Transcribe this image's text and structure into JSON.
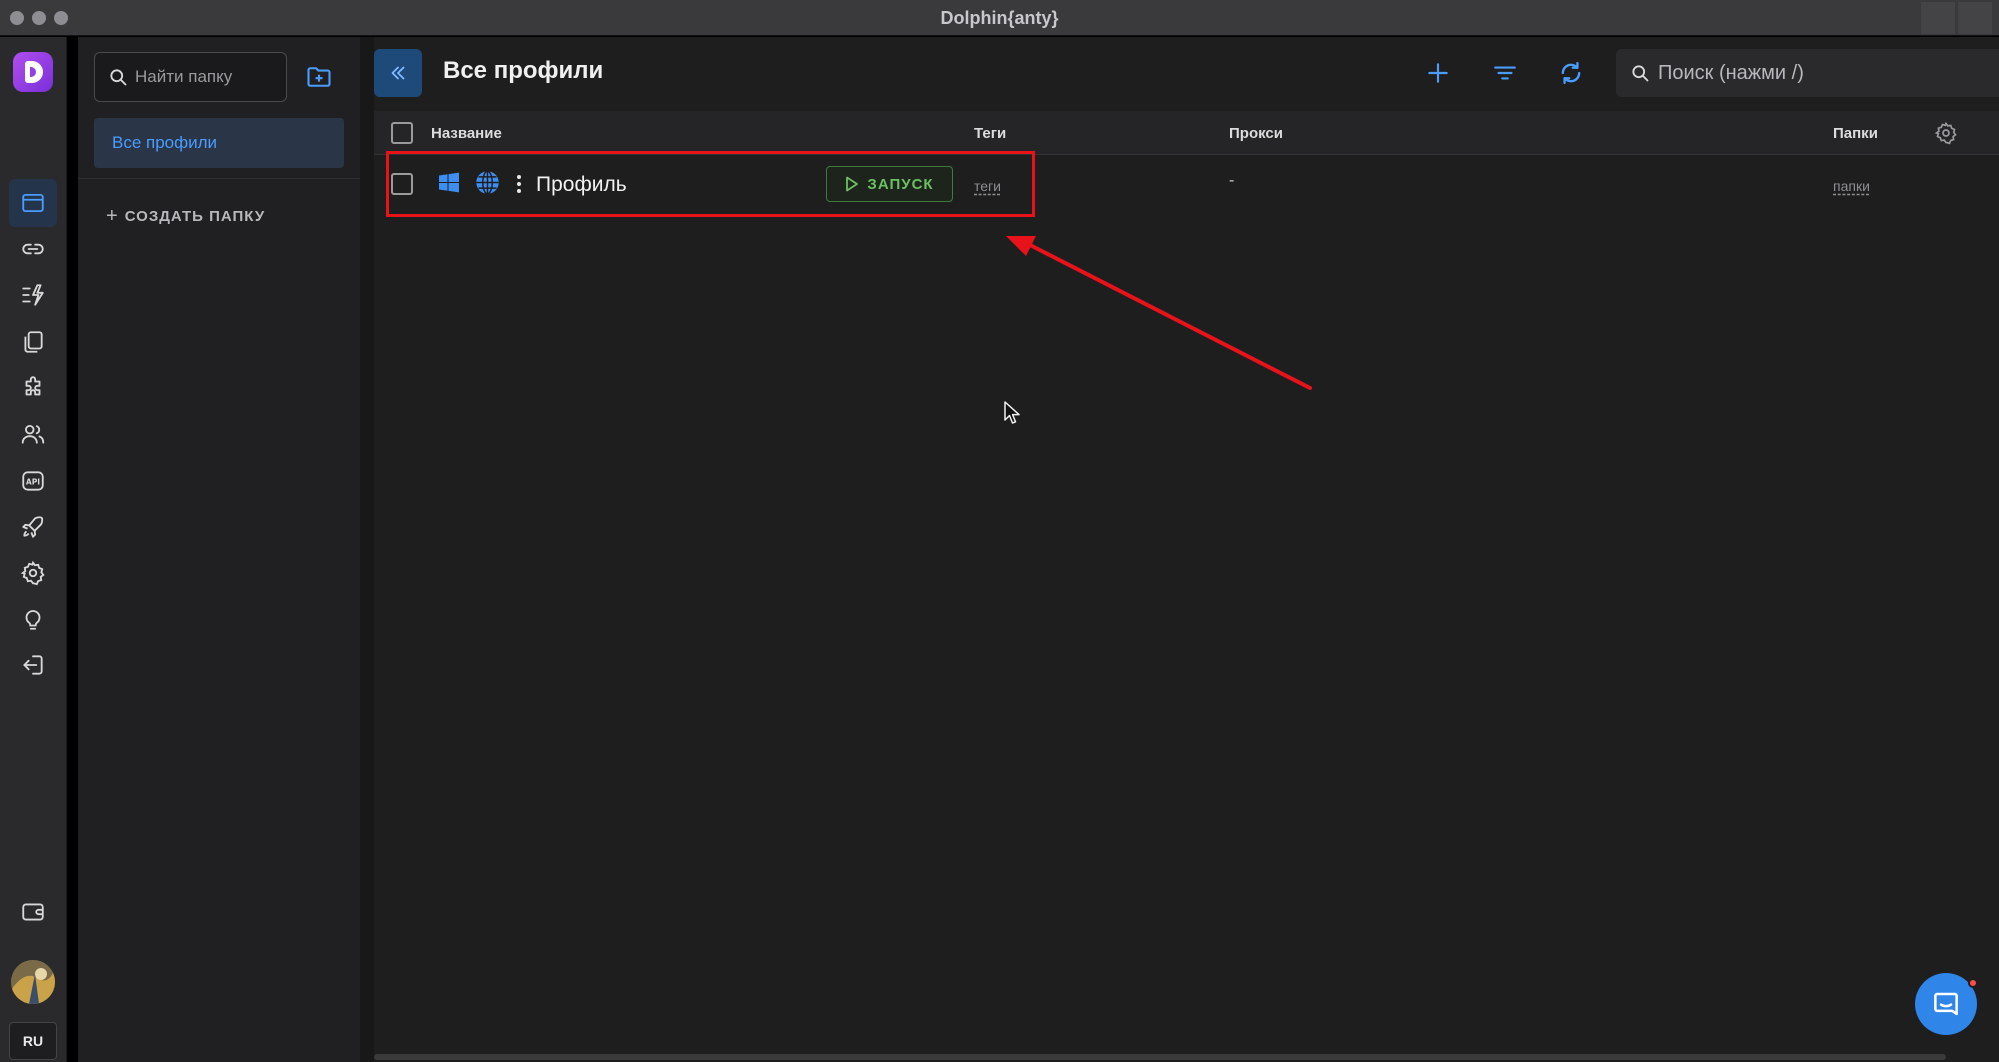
{
  "window": {
    "title": "Dolphin{anty}"
  },
  "colors": {
    "accent": "#4a9cff",
    "launch": "#6cbf62",
    "highlight": "#e8121b",
    "chat": "#2f86e8"
  },
  "rail": {
    "items": [
      {
        "icon": "browser-profiles-icon",
        "active": true
      },
      {
        "icon": "link-icon"
      },
      {
        "icon": "automation-icon"
      },
      {
        "icon": "copy-icon"
      },
      {
        "icon": "extension-icon"
      },
      {
        "icon": "users-icon"
      },
      {
        "icon": "api-icon"
      },
      {
        "icon": "rocket-icon"
      },
      {
        "icon": "settings-icon"
      },
      {
        "icon": "lightbulb-icon"
      },
      {
        "icon": "logout-icon"
      }
    ],
    "wallet_icon": "wallet-icon",
    "language": "RU"
  },
  "folders": {
    "search_placeholder": "Найти папку",
    "selected": "Все профили",
    "create_label": "СОЗДАТЬ ПАПКУ"
  },
  "header": {
    "title": "Все профили",
    "search_placeholder": "Поиск (нажми /)"
  },
  "table": {
    "columns": {
      "name": "Название",
      "tags": "Теги",
      "proxy": "Прокси",
      "folders": "Папки"
    },
    "rows": [
      {
        "os": "windows-icon",
        "browser": "globe-icon",
        "name": "Профиль",
        "launch": "ЗАПУСК",
        "tags": "теги",
        "proxy": "-",
        "folders": "папки"
      }
    ]
  }
}
